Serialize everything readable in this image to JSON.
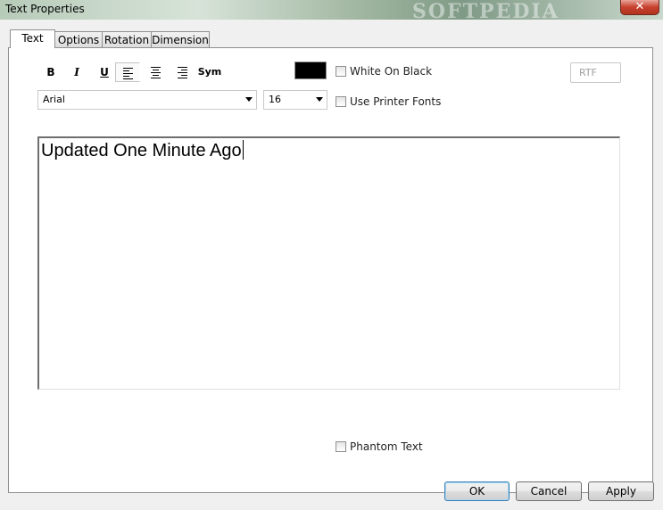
{
  "window": {
    "title": "Text Properties",
    "watermark": "SOFTPEDIA",
    "close_symbol": "✕"
  },
  "tabs": [
    {
      "label": "Text",
      "active": true
    },
    {
      "label": "Options",
      "active": false
    },
    {
      "label": "Rotation",
      "active": false
    },
    {
      "label": "Dimension",
      "active": false
    }
  ],
  "toolbar": {
    "bold": "B",
    "italic": "I",
    "underline": "U",
    "symbol": "Sym",
    "align_left_pressed": true
  },
  "color": {
    "text_color": "#000000"
  },
  "checkboxes": {
    "white_on_black": {
      "label": "White On Black",
      "checked": false
    },
    "use_printer_fonts": {
      "label": "Use Printer Fonts",
      "checked": false
    },
    "phantom_text": {
      "label": "Phantom Text",
      "checked": false
    }
  },
  "rtf_button": {
    "label": "RTF",
    "enabled": false
  },
  "font": {
    "family": "Arial",
    "size": "16"
  },
  "editor": {
    "content": "Updated One Minute Ago"
  },
  "buttons": {
    "ok": "OK",
    "cancel": "Cancel",
    "apply": "Apply"
  }
}
